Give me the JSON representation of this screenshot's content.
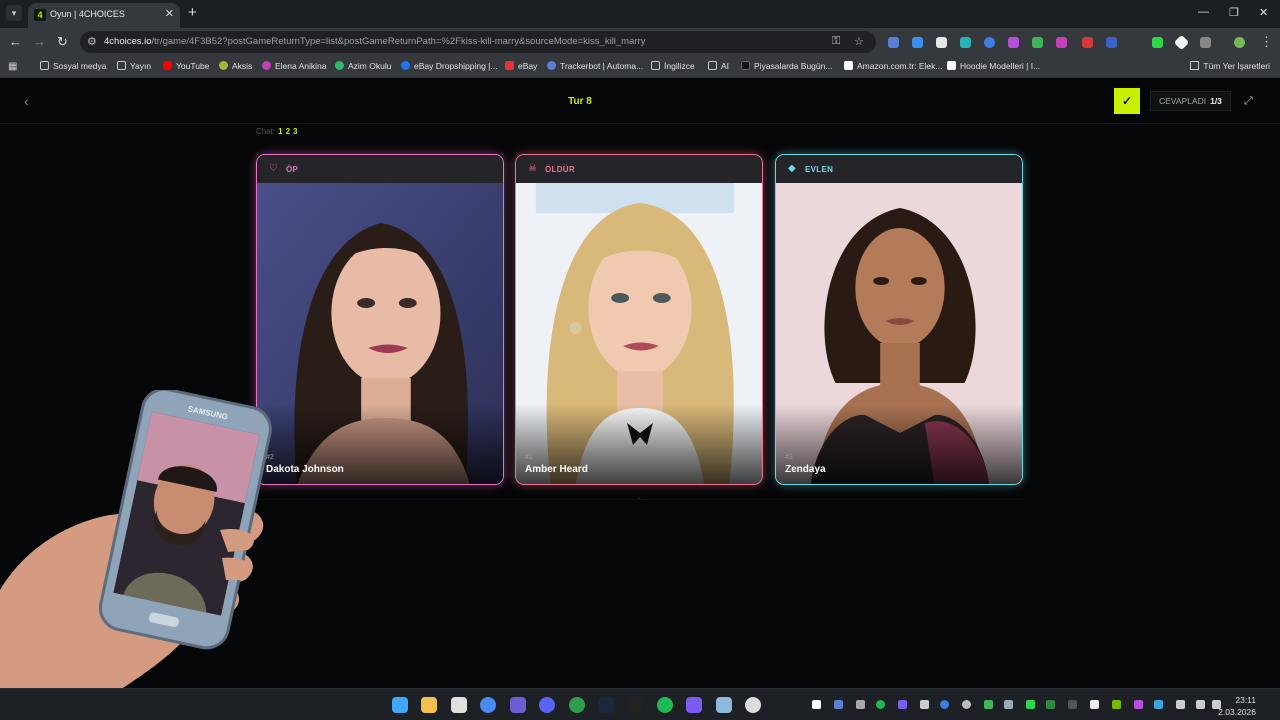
{
  "browser": {
    "tab_title": "Oyun | 4CHOICES",
    "tab_favicon_text": "4",
    "url_domain": "4choices.io",
    "url_path": "/tr/game/4F3B52?postGameReturnType=list&postGameReturnPath=%2Fkiss-kill-marry&sourceMode=kiss_kill_marry"
  },
  "bookmarks": {
    "items": [
      {
        "label": "Sosyal medya",
        "icon": "folder-icon",
        "color": "#c9c9c9"
      },
      {
        "label": "Yayın",
        "icon": "folder-icon",
        "color": "#c9c9c9"
      },
      {
        "label": "YouTube",
        "icon": "youtube-icon",
        "color": "#ff0000"
      },
      {
        "label": "Aksis",
        "icon": "aksis-icon",
        "color": "#a6b536"
      },
      {
        "label": "Elena Anikina",
        "icon": "elena-icon",
        "color": "#c23fb5"
      },
      {
        "label": "Azim Okulu",
        "icon": "azim-icon",
        "color": "#2fb86a"
      },
      {
        "label": "eBay Dropshipping |...",
        "icon": "facebook-icon",
        "color": "#1877f2"
      },
      {
        "label": "eBay",
        "icon": "ebay-icon",
        "color": "#e53238"
      },
      {
        "label": "Trackerbot | Automa...",
        "icon": "trackerbot-icon",
        "color": "#5a7fd6"
      },
      {
        "label": "İngilizce",
        "icon": "folder-icon",
        "color": "#c9c9c9"
      },
      {
        "label": "AI",
        "icon": "folder-icon",
        "color": "#c9c9c9"
      },
      {
        "label": "Piyasalarda Bugün...",
        "icon": "tv-icon",
        "color": "#111111"
      },
      {
        "label": "Amazon.com.tr: Elek...",
        "icon": "amazon-icon",
        "color": "#ffffff"
      },
      {
        "label": "Hoodie Modelleri | I...",
        "icon": "hoodie-icon",
        "color": "#ffffff"
      }
    ],
    "all_bookmarks": "Tüm Yer İşaretleri"
  },
  "game": {
    "round_title": "Tur 8",
    "answered_label": "CEVAPLADI",
    "answered_count": "1/3",
    "chat_label": "Chat:",
    "chat_numbers": [
      "1",
      "2",
      "3"
    ],
    "cards": [
      {
        "label": "ÖP",
        "icon": "heart-icon",
        "rank": "#2",
        "name": "Dakota Johnson",
        "accent": "#e872c8"
      },
      {
        "label": "ÖLDÜR",
        "icon": "skull-icon",
        "rank": "#1",
        "name": "Amber Heard",
        "accent": "#f07090"
      },
      {
        "label": "EVLEN",
        "icon": "diamond-icon",
        "rank": "#3",
        "name": "Zendaya",
        "accent": "#6fd8e8"
      }
    ]
  },
  "phone": {
    "brand": "SAMSUNG"
  },
  "taskbar": {
    "time": "23:11",
    "date": "2.03.2026"
  },
  "colors": {
    "accent": "#c8f000",
    "background": "#050607"
  }
}
